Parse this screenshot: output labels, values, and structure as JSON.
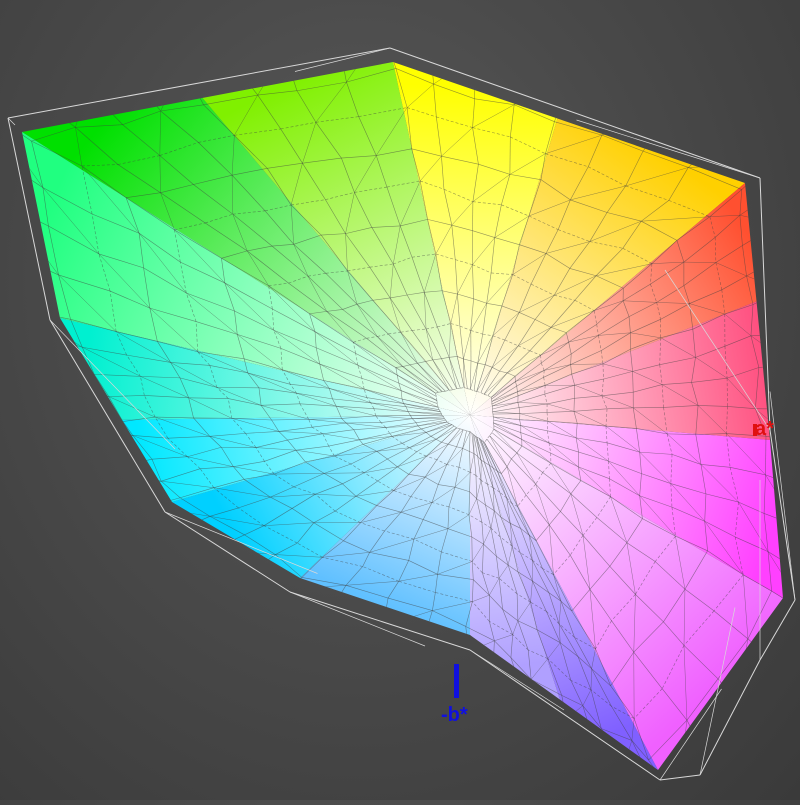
{
  "axes": {
    "a_label": "a*",
    "b_label": "-b*",
    "a_color": "#e01010",
    "b_color": "#1010e0"
  },
  "gamut": {
    "corner_colors": {
      "green": "#00e000",
      "yellow": "#ffff00",
      "red": "#ff5030",
      "magenta": "#ff40ff",
      "blue": "#8060ff",
      "cyan": "#00e8ff",
      "white": "#ffffff"
    },
    "mesh_color": "#404040",
    "outline_color": "#d8d8d8"
  }
}
